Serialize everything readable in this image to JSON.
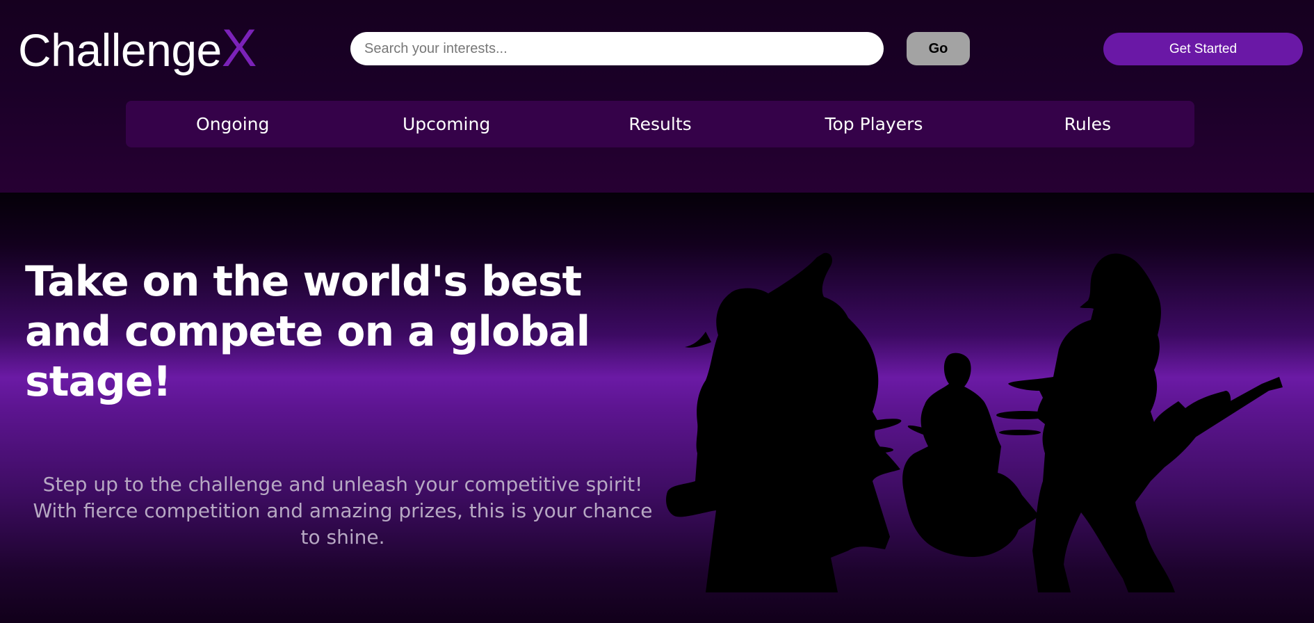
{
  "header": {
    "logo": {
      "text": "Challenge",
      "accent": "X"
    },
    "search": {
      "placeholder": "Search your interests...",
      "value": ""
    },
    "go_label": "Go",
    "get_started_label": "Get Started"
  },
  "nav": {
    "items": [
      {
        "label": "Ongoing"
      },
      {
        "label": "Upcoming"
      },
      {
        "label": "Results"
      },
      {
        "label": "Top Players"
      },
      {
        "label": "Rules"
      }
    ]
  },
  "hero": {
    "title": "Take on the world's best and compete on a global stage!",
    "description": "Step up to the challenge and unleash your competitive spirit! With fierce competition and amazing prizes, this is your chance to shine.",
    "image": "band-silhouette-illustration"
  },
  "colors": {
    "accent": "#7b22b8",
    "button_primary": "#6a18a6",
    "nav_background": "#350249",
    "go_button": "#a3a3a3"
  }
}
